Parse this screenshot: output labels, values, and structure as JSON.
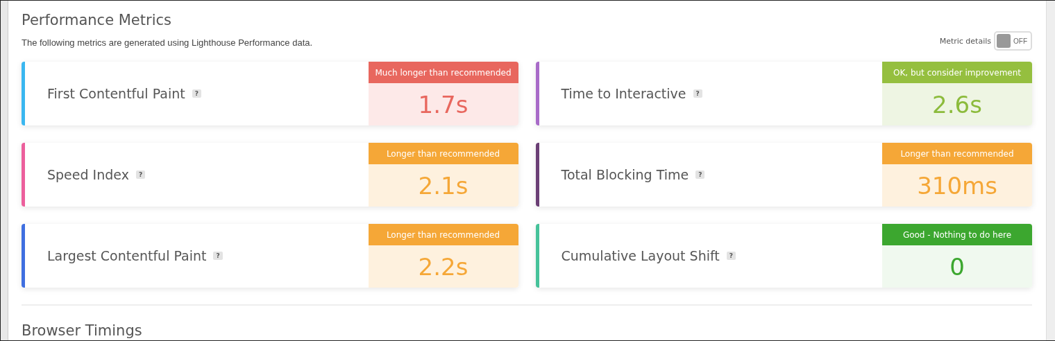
{
  "section": {
    "title": "Performance Metrics",
    "description": "The following metrics are generated using Lighthouse Performance data."
  },
  "toggle": {
    "label": "Metric details",
    "on": false,
    "state_text": "OFF"
  },
  "metrics": [
    {
      "name": "First Contentful Paint",
      "help": "?",
      "color": "#3ab7f0",
      "kind": "bad",
      "status": "Much longer than recommended",
      "value": "1.7s"
    },
    {
      "name": "Time to Interactive",
      "help": "?",
      "color": "#a86bc8",
      "kind": "ok",
      "status": "OK, but consider improvement",
      "value": "2.6s"
    },
    {
      "name": "Speed Index",
      "help": "?",
      "color": "#ec5f9c",
      "kind": "warn",
      "status": "Longer than recommended",
      "value": "2.1s"
    },
    {
      "name": "Total Blocking Time",
      "help": "?",
      "color": "#6b3f75",
      "kind": "warn",
      "status": "Longer than recommended",
      "value": "310ms"
    },
    {
      "name": "Largest Contentful Paint",
      "help": "?",
      "color": "#3f6fe0",
      "kind": "warn",
      "status": "Longer than recommended",
      "value": "2.2s"
    },
    {
      "name": "Cumulative Layout Shift",
      "help": "?",
      "color": "#46c29a",
      "kind": "good",
      "status": "Good - Nothing to do here",
      "value": "0"
    }
  ],
  "next_section": {
    "title": "Browser Timings"
  }
}
